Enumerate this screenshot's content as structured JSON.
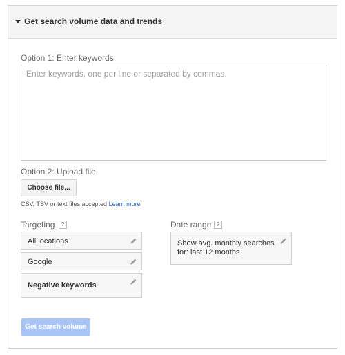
{
  "panel": {
    "title": "Get search volume data and trends"
  },
  "option1": {
    "label": "Option 1: Enter keywords",
    "placeholder": "Enter keywords, one per line or separated by commas.",
    "value": ""
  },
  "option2": {
    "label": "Option 2: Upload file",
    "button_label": "Choose file...",
    "note_text": "CSV, TSV or text files accepted",
    "link_text": "Learn more"
  },
  "targeting": {
    "label": "Targeting",
    "help": "?",
    "items": [
      {
        "label": "All locations"
      },
      {
        "label": "Google"
      },
      {
        "label": "Negative keywords"
      }
    ]
  },
  "date_range": {
    "label": "Date range",
    "help": "?",
    "value": "Show avg. monthly searches for: last 12 months"
  },
  "submit": {
    "label": "Get search volume"
  },
  "colors": {
    "header_bg": "#f5f5f5",
    "link": "#2a66c4",
    "submit_disabled": "#a9c4f5",
    "chip_bg": "#f7f7f7"
  }
}
